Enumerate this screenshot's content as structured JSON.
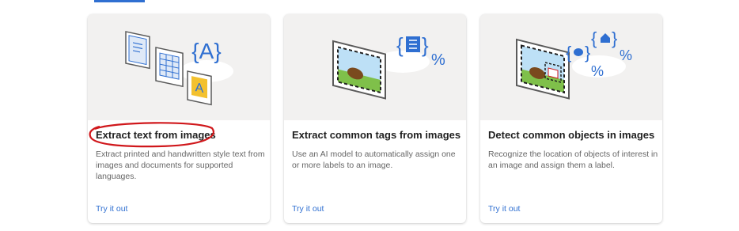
{
  "colors": {
    "accent": "#2f6fd1",
    "link": "#2f6fd1",
    "annotation": "#d0171b"
  },
  "cards": [
    {
      "title": "Extract text from images",
      "description": "Extract printed and handwritten style text from images and documents for supported languages.",
      "link": "Try it out",
      "illustration": "ocr-documents-illustration",
      "glyph_braces": "{A}",
      "glyph_letter": "A"
    },
    {
      "title": "Extract common tags from images",
      "description": "Use an AI model to automatically assign one or more labels to an image.",
      "link": "Try it out",
      "illustration": "image-tagging-illustration",
      "glyph_percent": "%"
    },
    {
      "title": "Detect common objects in images",
      "description": "Recognize the location of objects of interest in an image and assign them a label.",
      "link": "Try it out",
      "illustration": "object-detection-illustration",
      "glyph_percent": "%"
    }
  ]
}
